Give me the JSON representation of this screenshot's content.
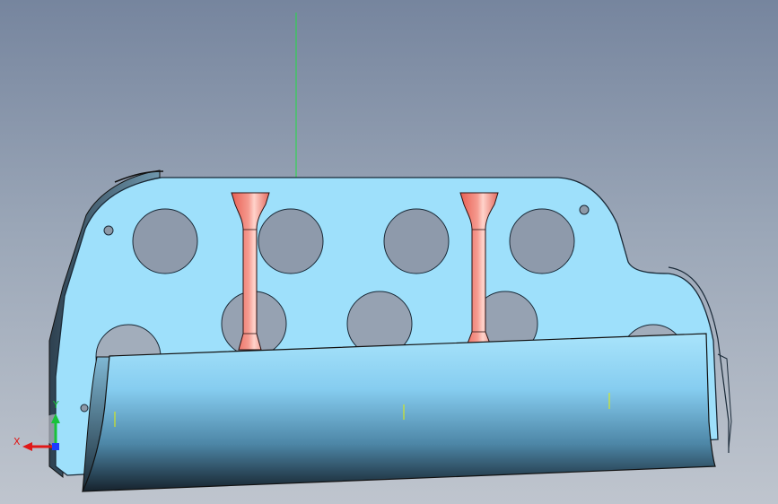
{
  "viewport": {
    "background_top": "#76859e",
    "background_bottom": "#bfc5ce"
  },
  "model": {
    "plate_color": "#9ee0fb",
    "plate_outline": "#1a2a38",
    "valve_color": "#f07a6e",
    "valve_highlight": "#ffd0c8",
    "blade_top_color": "#8fd6f8",
    "blade_bottom_color": "#1b2a36",
    "axis_line_color": "#22dd44",
    "marker_color": "#e6f000"
  },
  "triad": {
    "x_label": "X",
    "y_label": "Y",
    "x_color": "#e01818",
    "y_color": "#19c23a",
    "z_color": "#1c3cff"
  }
}
